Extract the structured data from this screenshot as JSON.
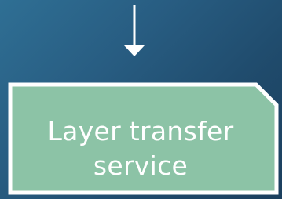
{
  "diagram": {
    "node": {
      "label": "Layer transfer service"
    },
    "colors": {
      "node_fill": "#8cc3a6",
      "node_border": "#ffffff",
      "arrow": "#ffffff"
    }
  }
}
